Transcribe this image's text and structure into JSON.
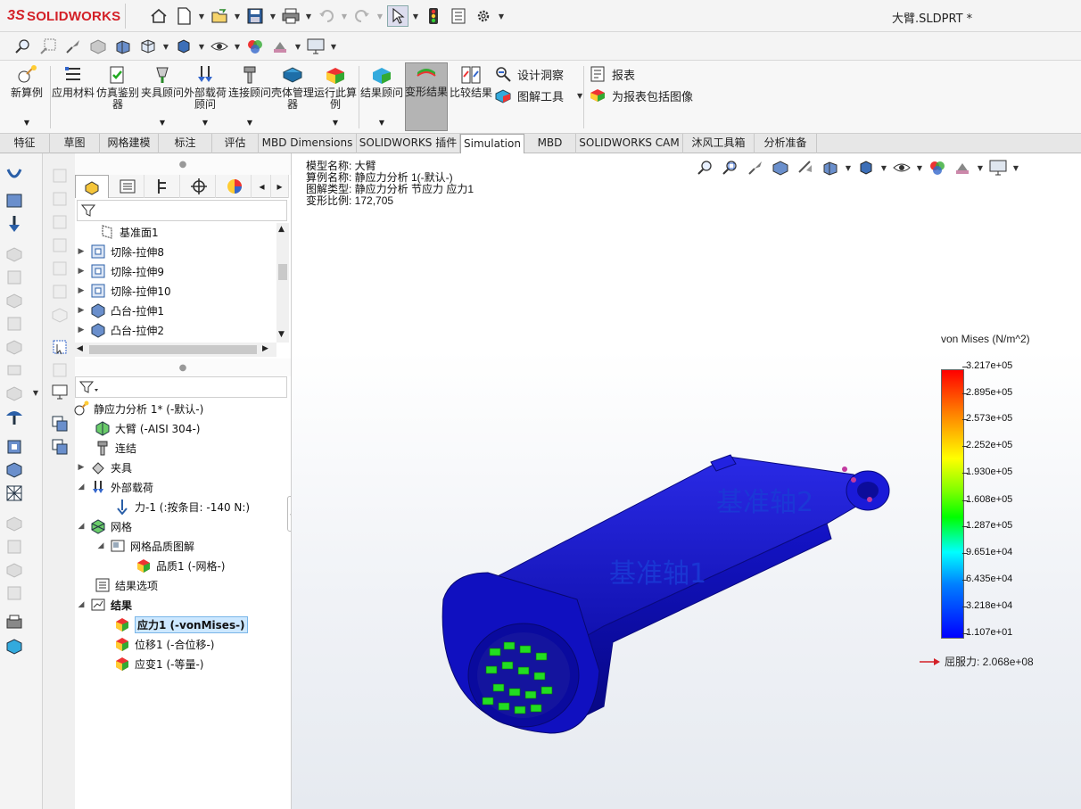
{
  "app": {
    "logo_prefix": "3S",
    "logo_text": "SOLIDWORKS",
    "document_title": "大臂.SLDPRT *"
  },
  "ribbon": {
    "buttons": [
      {
        "label": "新算例"
      },
      {
        "label": "应用材料"
      },
      {
        "label": "仿真鉴别器"
      },
      {
        "label": "夹具顾问"
      },
      {
        "label": "外部载荷顾问"
      },
      {
        "label": "连接顾问"
      },
      {
        "label": "壳体管理器"
      },
      {
        "label": "运行此算例"
      },
      {
        "label": "结果顾问"
      },
      {
        "label": "变形结果"
      },
      {
        "label": "比较结果"
      }
    ],
    "small": [
      {
        "label": "设计洞察"
      },
      {
        "label": "图解工具"
      },
      {
        "label": "报表"
      },
      {
        "label": "为报表包括图像"
      }
    ]
  },
  "tabs": [
    {
      "label": "特征"
    },
    {
      "label": "草图"
    },
    {
      "label": "网格建模"
    },
    {
      "label": "标注"
    },
    {
      "label": "评估"
    },
    {
      "label": "MBD Dimensions"
    },
    {
      "label": "SOLIDWORKS 插件"
    },
    {
      "label": "Simulation"
    },
    {
      "label": "MBD"
    },
    {
      "label": "SOLIDWORKS CAM"
    },
    {
      "label": "沐风工具箱"
    },
    {
      "label": "分析准备"
    }
  ],
  "feature_tree": [
    {
      "label": "基准面1"
    },
    {
      "label": "切除-拉伸8"
    },
    {
      "label": "切除-拉伸9"
    },
    {
      "label": "切除-拉伸10"
    },
    {
      "label": "凸台-拉伸1"
    },
    {
      "label": "凸台-拉伸2"
    }
  ],
  "study_tree": [
    {
      "label": "静应力分析 1* (-默认-)"
    },
    {
      "label": "大臂 (-AISI 304-)"
    },
    {
      "label": "连结"
    },
    {
      "label": "夹具"
    },
    {
      "label": "外部载荷"
    },
    {
      "label": "力-1 (:按条目: -140 N:)"
    },
    {
      "label": "网格"
    },
    {
      "label": "网格品质图解"
    },
    {
      "label": "品质1 (-网格-)"
    },
    {
      "label": "结果选项"
    },
    {
      "label": "结果"
    },
    {
      "label": "应力1 (-vonMises-)"
    },
    {
      "label": "位移1 (-合位移-)"
    },
    {
      "label": "应变1 (-等量-)"
    }
  ],
  "viewport": {
    "model_name": "模型名称: 大臂",
    "study_name": "算例名称: 静应力分析 1(-默认-)",
    "plot_type": "图解类型: 静应力分析 节应力 应力1",
    "deform_scale": "变形比例: 172,705",
    "datum_axis_1": "基准轴1",
    "datum_axis_2": "基准轴2"
  },
  "legend": {
    "title": "von Mises (N/m^2)",
    "ticks": [
      "3.217e+05",
      "2.895e+05",
      "2.573e+05",
      "2.252e+05",
      "1.930e+05",
      "1.608e+05",
      "1.287e+05",
      "9.651e+04",
      "6.435e+04",
      "3.218e+04",
      "1.107e+01"
    ],
    "yield_label": "屈服力: 2.068e+08"
  },
  "colors": {
    "brand": "#d32027",
    "part_blue": "#1414d8",
    "active_tab": "#ffffff"
  }
}
